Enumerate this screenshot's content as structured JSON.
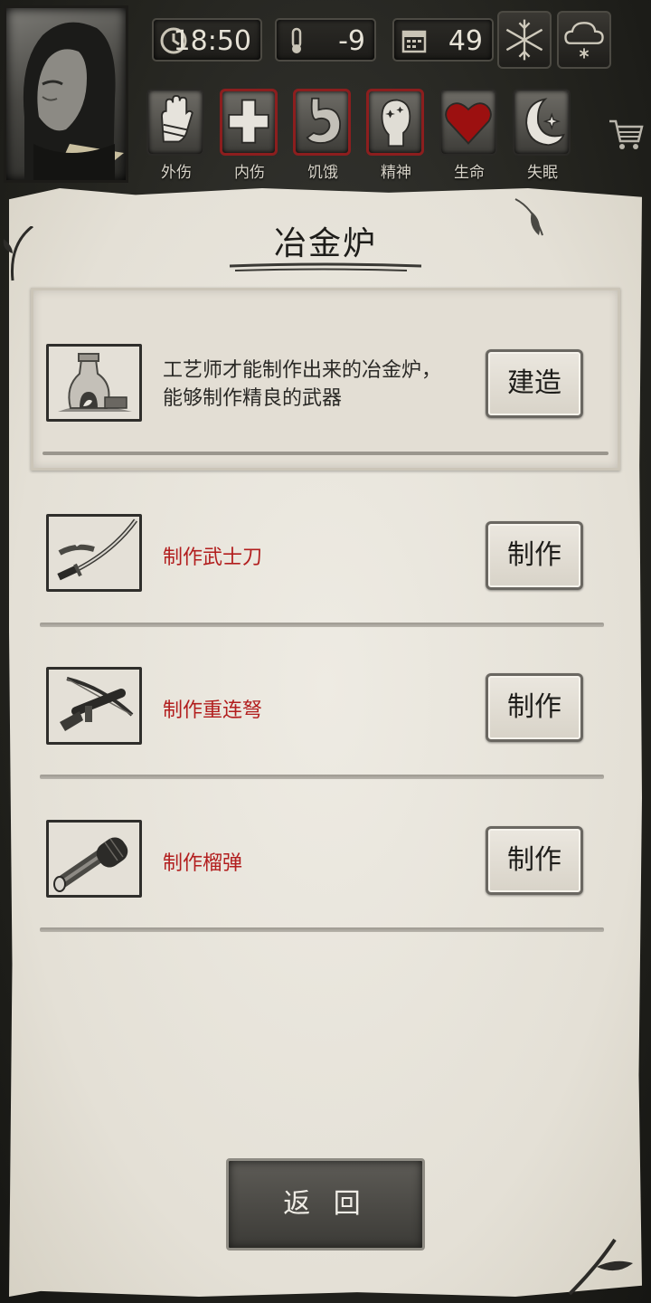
{
  "hud": {
    "time": "18:50",
    "temperature": "-9",
    "day": "49",
    "icons": {
      "clock": "clock-icon",
      "thermometer": "thermometer-icon",
      "calendar": "calendar-icon",
      "snowflake": "snowflake-icon",
      "snow_cloud": "snow-cloud-icon",
      "cart": "cart-icon"
    }
  },
  "statuses": [
    {
      "label": "外伤",
      "icon": "bandaged-hand-icon",
      "alert": false
    },
    {
      "label": "内伤",
      "icon": "medical-cross-icon",
      "alert": true
    },
    {
      "label": "饥饿",
      "icon": "stomach-icon",
      "alert": true
    },
    {
      "label": "精神",
      "icon": "head-stars-icon",
      "alert": true
    },
    {
      "label": "生命",
      "icon": "heart-icon",
      "alert": false
    },
    {
      "label": "失眠",
      "icon": "moon-star-icon",
      "alert": false
    }
  ],
  "panel": {
    "title": "冶金炉",
    "facility": {
      "icon": "furnace-icon",
      "description_line1": "工艺师才能制作出来的冶金炉，",
      "description_line2": "能够制作精良的武器",
      "button": "建造"
    },
    "recipes": [
      {
        "label": "制作武士刀",
        "icon": "katana-icon",
        "button": "制作"
      },
      {
        "label": "制作重连弩",
        "icon": "crossbow-icon",
        "button": "制作"
      },
      {
        "label": "制作榴弹",
        "icon": "grenade-icon",
        "button": "制作"
      }
    ]
  },
  "back_button": "返 回",
  "colors": {
    "alert_border": "#8c1e1e",
    "recipe_text": "#b21e1e",
    "heart": "#9c1010"
  }
}
